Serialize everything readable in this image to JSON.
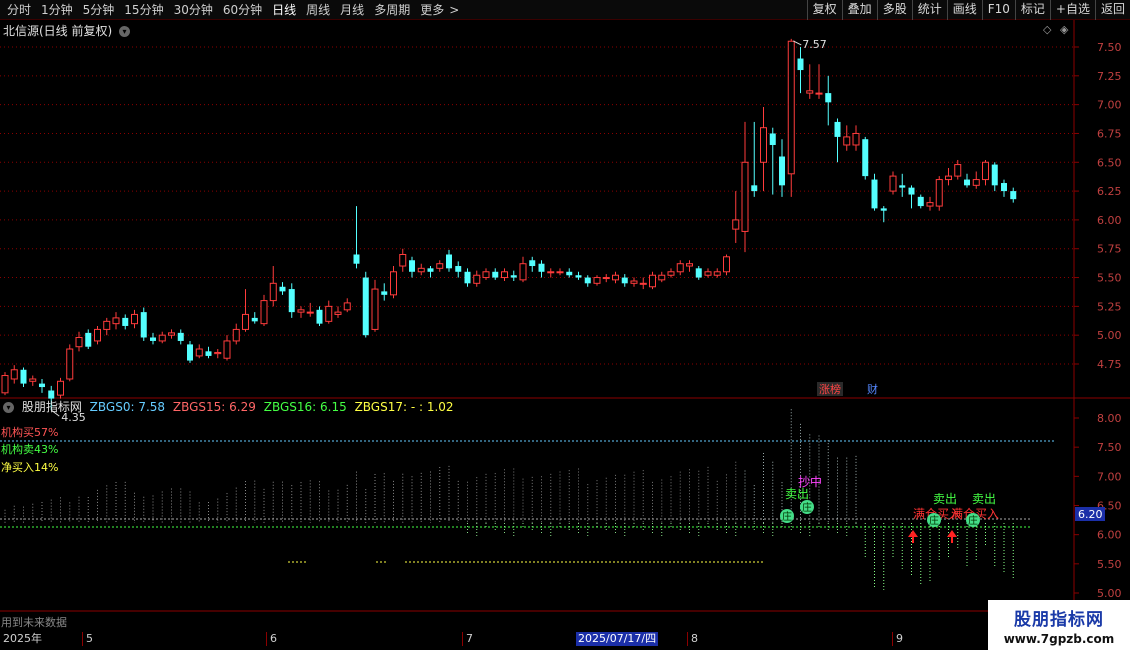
{
  "toolbar": {
    "periods": [
      "分时",
      "1分钟",
      "5分钟",
      "15分钟",
      "30分钟",
      "60分钟",
      "日线",
      "周线",
      "月线",
      "多周期",
      "更多"
    ],
    "active_period": "日线",
    "more_arrow": ">",
    "buttons": [
      "复权",
      "叠加",
      "多股",
      "统计",
      "画线",
      "F10",
      "标记",
      "+自选",
      "返回"
    ]
  },
  "stock": {
    "title": "北信源(日线 前复权)",
    "high_label": "7.57",
    "low_label": "4.35"
  },
  "price_axis": [
    "7.50",
    "7.25",
    "7.00",
    "6.75",
    "6.50",
    "6.25",
    "6.00",
    "5.75",
    "5.50",
    "5.25",
    "5.00",
    "4.75"
  ],
  "markers": {
    "limit_up": "涨榜",
    "fin": "财"
  },
  "indicator": {
    "name": "股朋指标网",
    "zbgs0_label": "ZBGS0: 7.58",
    "zbgs15_label": "ZBGS15: 6.29",
    "zbgs16_label": "ZBGS16: 6.15",
    "zbgs17_label": "ZBGS17: - : 1.02",
    "legend": [
      "机构买57%",
      "机构卖43%",
      "净买入14%"
    ],
    "axis": [
      "8.00",
      "7.50",
      "7.00",
      "6.50",
      "6.00",
      "5.50",
      "5.00"
    ],
    "current_value": "6.20",
    "signals": {
      "sell": "卖出",
      "enter": "抄中",
      "buy": "满仓买入",
      "zhuang": "庄"
    },
    "future_note": "用到未来数据"
  },
  "dates": {
    "year": "2025年",
    "months": [
      "5",
      "6",
      "7",
      "8",
      "9"
    ],
    "cursor": "2025/07/17/四"
  },
  "watermark": {
    "title": "股朋指标网",
    "url": "www.7gpzb.com"
  },
  "colors": {
    "up": "#ff3c3c",
    "down": "#54ffff",
    "grid": "#8b0000",
    "bg": "#000000"
  },
  "chart_data": {
    "type": "candlestick",
    "ylim": [
      4.35,
      7.57
    ],
    "candles": [
      [
        4.5,
        4.65,
        4.68,
        4.48
      ],
      [
        4.62,
        4.7,
        4.74,
        4.58
      ],
      [
        4.7,
        4.58,
        4.72,
        4.55
      ],
      [
        4.6,
        4.62,
        4.65,
        4.56
      ],
      [
        4.58,
        4.55,
        4.62,
        4.5
      ],
      [
        4.52,
        4.45,
        4.56,
        4.35
      ],
      [
        4.48,
        4.6,
        4.63,
        4.45
      ],
      [
        4.62,
        4.88,
        4.92,
        4.6
      ],
      [
        4.9,
        4.98,
        5.03,
        4.86
      ],
      [
        5.02,
        4.9,
        5.05,
        4.88
      ],
      [
        4.95,
        5.05,
        5.08,
        4.92
      ],
      [
        5.05,
        5.12,
        5.15,
        5.0
      ],
      [
        5.1,
        5.15,
        5.2,
        5.05
      ],
      [
        5.15,
        5.08,
        5.18,
        5.05
      ],
      [
        5.1,
        5.18,
        5.22,
        5.06
      ],
      [
        5.2,
        4.98,
        5.24,
        4.95
      ],
      [
        4.98,
        4.95,
        5.02,
        4.92
      ],
      [
        4.95,
        5.0,
        5.03,
        4.93
      ],
      [
        5.0,
        5.02,
        5.05,
        4.97
      ],
      [
        5.02,
        4.95,
        5.05,
        4.92
      ],
      [
        4.92,
        4.78,
        4.95,
        4.76
      ],
      [
        4.82,
        4.88,
        4.92,
        4.8
      ],
      [
        4.86,
        4.82,
        4.9,
        4.8
      ],
      [
        4.84,
        4.85,
        4.88,
        4.8
      ],
      [
        4.8,
        4.95,
        5.0,
        4.78
      ],
      [
        4.95,
        5.05,
        5.1,
        4.92
      ],
      [
        5.05,
        5.18,
        5.4,
        5.03
      ],
      [
        5.15,
        5.12,
        5.2,
        5.1
      ],
      [
        5.1,
        5.3,
        5.35,
        5.08
      ],
      [
        5.3,
        5.45,
        5.6,
        5.25
      ],
      [
        5.42,
        5.38,
        5.46,
        5.35
      ],
      [
        5.4,
        5.2,
        5.45,
        5.15
      ],
      [
        5.2,
        5.22,
        5.25,
        5.15
      ],
      [
        5.2,
        5.2,
        5.28,
        5.16
      ],
      [
        5.22,
        5.1,
        5.25,
        5.08
      ],
      [
        5.12,
        5.25,
        5.3,
        5.1
      ],
      [
        5.18,
        5.2,
        5.25,
        5.15
      ],
      [
        5.22,
        5.28,
        5.32,
        5.2
      ],
      [
        5.7,
        5.62,
        6.12,
        5.58
      ],
      [
        5.5,
        5.0,
        5.55,
        4.98
      ],
      [
        5.05,
        5.4,
        5.48,
        5.03
      ],
      [
        5.38,
        5.35,
        5.45,
        5.3
      ],
      [
        5.35,
        5.55,
        5.6,
        5.32
      ],
      [
        5.6,
        5.7,
        5.75,
        5.55
      ],
      [
        5.65,
        5.55,
        5.68,
        5.5
      ],
      [
        5.55,
        5.58,
        5.62,
        5.52
      ],
      [
        5.58,
        5.55,
        5.6,
        5.5
      ],
      [
        5.58,
        5.62,
        5.65,
        5.55
      ],
      [
        5.7,
        5.58,
        5.74,
        5.55
      ],
      [
        5.6,
        5.55,
        5.64,
        5.5
      ],
      [
        5.55,
        5.45,
        5.58,
        5.42
      ],
      [
        5.45,
        5.52,
        5.56,
        5.42
      ],
      [
        5.5,
        5.55,
        5.58,
        5.48
      ],
      [
        5.55,
        5.5,
        5.58,
        5.48
      ],
      [
        5.5,
        5.55,
        5.58,
        5.47
      ],
      [
        5.52,
        5.5,
        5.56,
        5.47
      ],
      [
        5.48,
        5.62,
        5.68,
        5.46
      ],
      [
        5.65,
        5.6,
        5.68,
        5.55
      ],
      [
        5.62,
        5.55,
        5.65,
        5.5
      ],
      [
        5.55,
        5.55,
        5.58,
        5.5
      ],
      [
        5.55,
        5.55,
        5.58,
        5.52
      ],
      [
        5.55,
        5.52,
        5.58,
        5.5
      ],
      [
        5.52,
        5.5,
        5.55,
        5.48
      ],
      [
        5.5,
        5.45,
        5.52,
        5.42
      ],
      [
        5.45,
        5.5,
        5.52,
        5.43
      ],
      [
        5.5,
        5.5,
        5.53,
        5.46
      ],
      [
        5.48,
        5.52,
        5.55,
        5.45
      ],
      [
        5.5,
        5.45,
        5.53,
        5.42
      ],
      [
        5.45,
        5.47,
        5.5,
        5.42
      ],
      [
        5.45,
        5.45,
        5.5,
        5.4
      ],
      [
        5.42,
        5.52,
        5.55,
        5.4
      ],
      [
        5.48,
        5.52,
        5.55,
        5.46
      ],
      [
        5.52,
        5.55,
        5.58,
        5.5
      ],
      [
        5.55,
        5.62,
        5.65,
        5.52
      ],
      [
        5.6,
        5.62,
        5.65,
        5.55
      ],
      [
        5.58,
        5.5,
        5.6,
        5.48
      ],
      [
        5.52,
        5.55,
        5.58,
        5.5
      ],
      [
        5.52,
        5.55,
        5.58,
        5.5
      ],
      [
        5.55,
        5.68,
        5.7,
        5.52
      ],
      [
        5.92,
        6.0,
        6.25,
        5.8
      ],
      [
        5.9,
        6.5,
        6.85,
        5.72
      ],
      [
        6.3,
        6.25,
        6.85,
        6.2
      ],
      [
        6.5,
        6.8,
        6.98,
        6.25
      ],
      [
        6.75,
        6.65,
        6.8,
        6.22
      ],
      [
        6.55,
        6.3,
        6.7,
        6.2
      ],
      [
        6.4,
        7.55,
        7.57,
        6.2
      ],
      [
        7.4,
        7.3,
        7.5,
        7.1
      ],
      [
        7.1,
        7.12,
        7.35,
        7.05
      ],
      [
        7.1,
        7.1,
        7.35,
        7.05
      ],
      [
        7.1,
        7.02,
        7.25,
        6.82
      ],
      [
        6.85,
        6.72,
        6.88,
        6.5
      ],
      [
        6.65,
        6.72,
        6.82,
        6.6
      ],
      [
        6.65,
        6.75,
        6.82,
        6.6
      ],
      [
        6.7,
        6.38,
        6.72,
        6.35
      ],
      [
        6.35,
        6.1,
        6.4,
        6.08
      ],
      [
        6.1,
        6.08,
        6.12,
        5.98
      ],
      [
        6.25,
        6.38,
        6.42,
        6.22
      ],
      [
        6.3,
        6.28,
        6.4,
        6.2
      ],
      [
        6.28,
        6.22,
        6.3,
        6.1
      ],
      [
        6.2,
        6.12,
        6.22,
        6.1
      ],
      [
        6.12,
        6.15,
        6.2,
        6.08
      ],
      [
        6.12,
        6.35,
        6.38,
        6.08
      ],
      [
        6.35,
        6.38,
        6.45,
        6.3
      ],
      [
        6.38,
        6.48,
        6.52,
        6.35
      ],
      [
        6.35,
        6.3,
        6.4,
        6.28
      ],
      [
        6.3,
        6.35,
        6.42,
        6.27
      ],
      [
        6.35,
        6.5,
        6.52,
        6.3
      ],
      [
        6.48,
        6.3,
        6.5,
        6.25
      ],
      [
        6.32,
        6.25,
        6.35,
        6.2
      ],
      [
        6.25,
        6.18,
        6.28,
        6.15
      ]
    ]
  }
}
